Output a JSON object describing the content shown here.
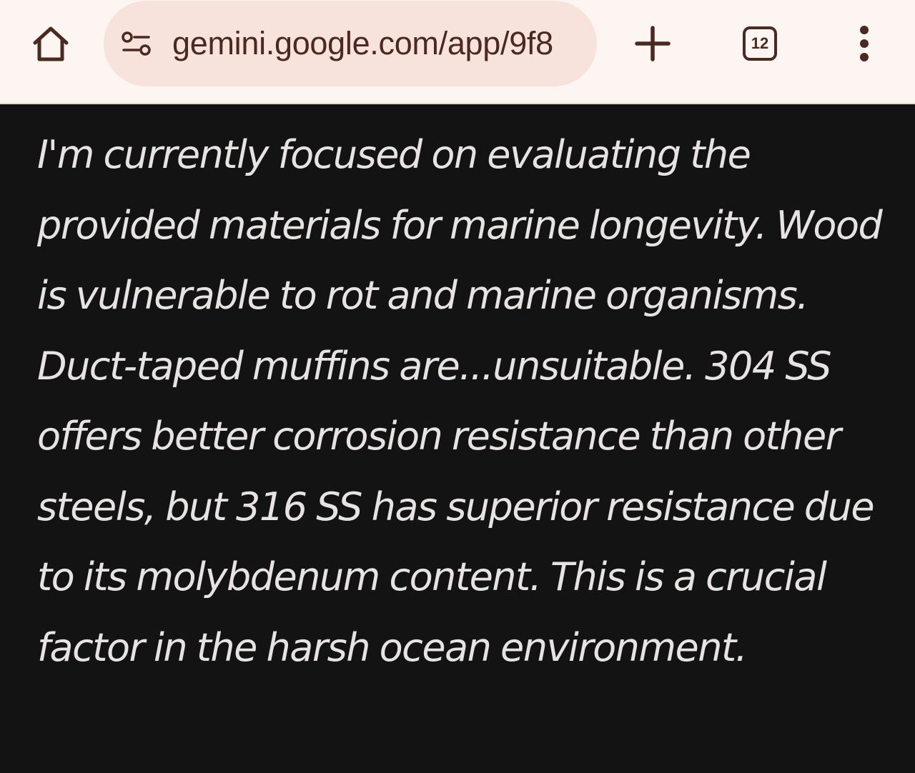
{
  "browser": {
    "url": "gemini.google.com/app/9f8",
    "tab_count": "12",
    "icons": {
      "home": "home-icon",
      "site_info": "site-settings-icon",
      "new_tab": "plus-icon",
      "tabs": "tab-switcher-icon",
      "menu": "more-vert-icon"
    },
    "colors": {
      "toolbar_bg": "#fdf5f2",
      "omnibox_bg": "#f7e3dc",
      "icon": "#4a2a20"
    }
  },
  "content": {
    "paragraph": "I'm currently focused on evaluating the provided materials for marine longevity. Wood is vulnerable to rot and marine organisms. Duct-taped muffins are...unsuitable. 304 SS offers better corrosion resistance than other steels, but 316 SS has superior resistance due to its molybdenum content. This is a crucial factor in the harsh ocean environment.",
    "colors": {
      "background": "#131313",
      "text": "#e6e3e2"
    }
  }
}
